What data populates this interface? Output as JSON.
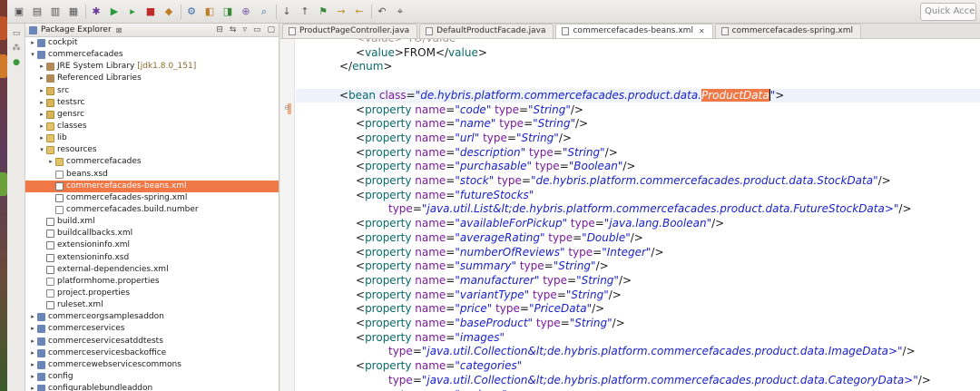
{
  "toolbar": {
    "quick_access_label": "Quick Access",
    "icons": [
      "new-icon",
      "save-icon",
      "save-all-icon",
      "print-icon",
      "debug-icon",
      "run-icon",
      "run-ext-icon",
      "stop-icon",
      "coverage-icon",
      "build-icon",
      "new-java-icon",
      "new-class-icon",
      "open-type-icon",
      "search-icon",
      "next-annotation-icon",
      "prev-annotation-icon",
      "toggle-mark-icon",
      "forward-icon",
      "back-icon",
      "last-edit-icon",
      "pin-icon"
    ]
  },
  "package_explorer": {
    "title": "Package Explorer",
    "items": [
      {
        "label": "cockpit",
        "depth": 0,
        "arrow": "▸",
        "icon": "project"
      },
      {
        "label": "commercefacades",
        "depth": 0,
        "arrow": "▾",
        "icon": "project"
      },
      {
        "label": "JRE System Library",
        "suffix": " [jdk1.8.0_151]",
        "depth": 1,
        "arrow": "▸",
        "icon": "jar"
      },
      {
        "label": "Referenced Libraries",
        "depth": 1,
        "arrow": "▸",
        "icon": "jar"
      },
      {
        "label": "src",
        "depth": 1,
        "arrow": "▸",
        "icon": "pkgfolder"
      },
      {
        "label": "testsrc",
        "depth": 1,
        "arrow": "▸",
        "icon": "pkgfolder"
      },
      {
        "label": "gensrc",
        "depth": 1,
        "arrow": "▸",
        "icon": "pkgfolder"
      },
      {
        "label": "classes",
        "depth": 1,
        "arrow": "▸",
        "icon": "folder"
      },
      {
        "label": "lib",
        "depth": 1,
        "arrow": "▸",
        "icon": "folder"
      },
      {
        "label": "resources",
        "depth": 1,
        "arrow": "▾",
        "icon": "folder"
      },
      {
        "label": "commercefacades",
        "depth": 2,
        "arrow": "▸",
        "icon": "folder"
      },
      {
        "label": "beans.xsd",
        "depth": 2,
        "arrow": "",
        "icon": "file"
      },
      {
        "label": "commercefacades-beans.xml",
        "depth": 2,
        "arrow": "",
        "icon": "xml",
        "selected": true
      },
      {
        "label": "commercefacades-spring.xml",
        "depth": 2,
        "arrow": "",
        "icon": "xml"
      },
      {
        "label": "commercefacades.build.number",
        "depth": 2,
        "arrow": "",
        "icon": "file"
      },
      {
        "label": "build.xml",
        "depth": 1,
        "arrow": "",
        "icon": "xml"
      },
      {
        "label": "buildcallbacks.xml",
        "depth": 1,
        "arrow": "",
        "icon": "xml"
      },
      {
        "label": "extensioninfo.xml",
        "depth": 1,
        "arrow": "",
        "icon": "xml"
      },
      {
        "label": "extensioninfo.xsd",
        "depth": 1,
        "arrow": "",
        "icon": "xml"
      },
      {
        "label": "external-dependencies.xml",
        "depth": 1,
        "arrow": "",
        "icon": "xml"
      },
      {
        "label": "platformhome.properties",
        "depth": 1,
        "arrow": "",
        "icon": "file"
      },
      {
        "label": "project.properties",
        "depth": 1,
        "arrow": "",
        "icon": "file"
      },
      {
        "label": "ruleset.xml",
        "depth": 1,
        "arrow": "",
        "icon": "xml"
      },
      {
        "label": "commerceorgsamplesaddon",
        "depth": 0,
        "arrow": "▸",
        "icon": "project"
      },
      {
        "label": "commerceservices",
        "depth": 0,
        "arrow": "▸",
        "icon": "project"
      },
      {
        "label": "commerceservicesatddtests",
        "depth": 0,
        "arrow": "▸",
        "icon": "project"
      },
      {
        "label": "commerceservicesbackoffice",
        "depth": 0,
        "arrow": "▸",
        "icon": "project"
      },
      {
        "label": "commercewebservicescommons",
        "depth": 0,
        "arrow": "▸",
        "icon": "project"
      },
      {
        "label": "config",
        "depth": 0,
        "arrow": "▸",
        "icon": "project"
      },
      {
        "label": "configurablebundleaddon",
        "depth": 0,
        "arrow": "▸",
        "icon": "project"
      }
    ]
  },
  "editor": {
    "tabs": [
      {
        "label": "ProductPageController.java",
        "active": false,
        "closable": false
      },
      {
        "label": "DefaultProductFacade.java",
        "active": false,
        "closable": false
      },
      {
        "label": "commercefacades-beans.xml",
        "active": true,
        "closable": true
      },
      {
        "label": "commercefacades-spring.xml",
        "active": false,
        "closable": false
      }
    ],
    "close_glyph": "✕",
    "lines": [
      {
        "indent": 2,
        "ghost": true,
        "segs": [
          [
            "p",
            "<"
          ],
          [
            "t",
            "value"
          ],
          [
            "p",
            "> "
          ],
          [
            "s",
            "TO/value"
          ]
        ]
      },
      {
        "indent": 2,
        "segs": [
          [
            "p",
            "<"
          ],
          [
            "t",
            "value"
          ],
          [
            "p",
            ">FROM</"
          ],
          [
            "t",
            "value"
          ],
          [
            "p",
            ">"
          ]
        ]
      },
      {
        "indent": 1,
        "segs": [
          [
            "p",
            "</"
          ],
          [
            "t",
            "enum"
          ],
          [
            "p",
            ">"
          ]
        ]
      },
      {
        "indent": 0,
        "segs": []
      },
      {
        "indent": 1,
        "cur": true,
        "segs": [
          [
            "p",
            "<"
          ],
          [
            "t",
            "bean"
          ],
          [
            "a",
            " class"
          ],
          [
            "p",
            "="
          ],
          [
            "s",
            "\"de.hybris.platform.commercefacades.product.data."
          ],
          [
            "hl",
            "ProductData"
          ],
          [
            "caret",
            ""
          ],
          [
            "s",
            "\""
          ],
          [
            "p",
            ">"
          ]
        ]
      },
      {
        "indent": 2,
        "segs": [
          [
            "p",
            "<"
          ],
          [
            "t",
            "property"
          ],
          [
            "a",
            " name"
          ],
          [
            "p",
            "="
          ],
          [
            "s",
            "\"code\""
          ],
          [
            "a",
            " type"
          ],
          [
            "p",
            "="
          ],
          [
            "s",
            "\"String\""
          ],
          [
            "p",
            "/>"
          ]
        ]
      },
      {
        "indent": 2,
        "segs": [
          [
            "p",
            "<"
          ],
          [
            "t",
            "property"
          ],
          [
            "a",
            " name"
          ],
          [
            "p",
            "="
          ],
          [
            "s",
            "\"name\""
          ],
          [
            "a",
            " type"
          ],
          [
            "p",
            "="
          ],
          [
            "s",
            "\"String\""
          ],
          [
            "p",
            "/>"
          ]
        ]
      },
      {
        "indent": 2,
        "segs": [
          [
            "p",
            "<"
          ],
          [
            "t",
            "property"
          ],
          [
            "a",
            " name"
          ],
          [
            "p",
            "="
          ],
          [
            "s",
            "\"url\""
          ],
          [
            "a",
            " type"
          ],
          [
            "p",
            "="
          ],
          [
            "s",
            "\"String\""
          ],
          [
            "p",
            "/>"
          ]
        ]
      },
      {
        "indent": 2,
        "segs": [
          [
            "p",
            "<"
          ],
          [
            "t",
            "property"
          ],
          [
            "a",
            " name"
          ],
          [
            "p",
            "="
          ],
          [
            "s",
            "\"description\""
          ],
          [
            "a",
            " type"
          ],
          [
            "p",
            "="
          ],
          [
            "s",
            "\"String\""
          ],
          [
            "p",
            "/>"
          ]
        ]
      },
      {
        "indent": 2,
        "segs": [
          [
            "p",
            "<"
          ],
          [
            "t",
            "property"
          ],
          [
            "a",
            " name"
          ],
          [
            "p",
            "="
          ],
          [
            "s",
            "\"purchasable\""
          ],
          [
            "a",
            " type"
          ],
          [
            "p",
            "="
          ],
          [
            "s",
            "\"Boolean\""
          ],
          [
            "p",
            "/>"
          ]
        ]
      },
      {
        "indent": 2,
        "segs": [
          [
            "p",
            "<"
          ],
          [
            "t",
            "property"
          ],
          [
            "a",
            " name"
          ],
          [
            "p",
            "="
          ],
          [
            "s",
            "\"stock\""
          ],
          [
            "a",
            " type"
          ],
          [
            "p",
            "="
          ],
          [
            "s",
            "\"de.hybris.platform.commercefacades.product.data.StockData\""
          ],
          [
            "p",
            "/>"
          ]
        ]
      },
      {
        "indent": 2,
        "segs": [
          [
            "p",
            "<"
          ],
          [
            "t",
            "property"
          ],
          [
            "a",
            " name"
          ],
          [
            "p",
            "="
          ],
          [
            "s",
            "\"futureStocks\""
          ]
        ]
      },
      {
        "indent": 4,
        "segs": [
          [
            "a",
            "type"
          ],
          [
            "p",
            "="
          ],
          [
            "s",
            "\"java.util.List&lt;de.hybris.platform.commercefacades.product.data.FutureStockData>\""
          ],
          [
            "p",
            "/>"
          ]
        ]
      },
      {
        "indent": 2,
        "segs": [
          [
            "p",
            "<"
          ],
          [
            "t",
            "property"
          ],
          [
            "a",
            " name"
          ],
          [
            "p",
            "="
          ],
          [
            "s",
            "\"availableForPickup\""
          ],
          [
            "a",
            " type"
          ],
          [
            "p",
            "="
          ],
          [
            "s",
            "\"java.lang.Boolean\""
          ],
          [
            "p",
            "/>"
          ]
        ]
      },
      {
        "indent": 2,
        "segs": [
          [
            "p",
            "<"
          ],
          [
            "t",
            "property"
          ],
          [
            "a",
            " name"
          ],
          [
            "p",
            "="
          ],
          [
            "s",
            "\"averageRating\""
          ],
          [
            "a",
            " type"
          ],
          [
            "p",
            "="
          ],
          [
            "s",
            "\"Double\""
          ],
          [
            "p",
            "/>"
          ]
        ]
      },
      {
        "indent": 2,
        "segs": [
          [
            "p",
            "<"
          ],
          [
            "t",
            "property"
          ],
          [
            "a",
            " name"
          ],
          [
            "p",
            "="
          ],
          [
            "s",
            "\"numberOfReviews\""
          ],
          [
            "a",
            " type"
          ],
          [
            "p",
            "="
          ],
          [
            "s",
            "\"Integer\""
          ],
          [
            "p",
            "/>"
          ]
        ]
      },
      {
        "indent": 2,
        "segs": [
          [
            "p",
            "<"
          ],
          [
            "t",
            "property"
          ],
          [
            "a",
            " name"
          ],
          [
            "p",
            "="
          ],
          [
            "s",
            "\"summary\""
          ],
          [
            "a",
            " type"
          ],
          [
            "p",
            "="
          ],
          [
            "s",
            "\"String\""
          ],
          [
            "p",
            "/>"
          ]
        ]
      },
      {
        "indent": 2,
        "segs": [
          [
            "p",
            "<"
          ],
          [
            "t",
            "property"
          ],
          [
            "a",
            " name"
          ],
          [
            "p",
            "="
          ],
          [
            "s",
            "\"manufacturer\""
          ],
          [
            "a",
            " type"
          ],
          [
            "p",
            "="
          ],
          [
            "s",
            "\"String\""
          ],
          [
            "p",
            "/>"
          ]
        ]
      },
      {
        "indent": 2,
        "segs": [
          [
            "p",
            "<"
          ],
          [
            "t",
            "property"
          ],
          [
            "a",
            " name"
          ],
          [
            "p",
            "="
          ],
          [
            "s",
            "\"variantType\""
          ],
          [
            "a",
            " type"
          ],
          [
            "p",
            "="
          ],
          [
            "s",
            "\"String\""
          ],
          [
            "p",
            "/>"
          ]
        ]
      },
      {
        "indent": 2,
        "segs": [
          [
            "p",
            "<"
          ],
          [
            "t",
            "property"
          ],
          [
            "a",
            " name"
          ],
          [
            "p",
            "="
          ],
          [
            "s",
            "\"price\""
          ],
          [
            "a",
            " type"
          ],
          [
            "p",
            "="
          ],
          [
            "s",
            "\"PriceData\""
          ],
          [
            "p",
            "/>"
          ]
        ]
      },
      {
        "indent": 2,
        "segs": [
          [
            "p",
            "<"
          ],
          [
            "t",
            "property"
          ],
          [
            "a",
            " name"
          ],
          [
            "p",
            "="
          ],
          [
            "s",
            "\"baseProduct\""
          ],
          [
            "a",
            " type"
          ],
          [
            "p",
            "="
          ],
          [
            "s",
            "\"String\""
          ],
          [
            "p",
            "/>"
          ]
        ]
      },
      {
        "indent": 2,
        "segs": [
          [
            "p",
            "<"
          ],
          [
            "t",
            "property"
          ],
          [
            "a",
            " name"
          ],
          [
            "p",
            "="
          ],
          [
            "s",
            "\"images\""
          ]
        ]
      },
      {
        "indent": 4,
        "segs": [
          [
            "a",
            "type"
          ],
          [
            "p",
            "="
          ],
          [
            "s",
            "\"java.util.Collection&lt;de.hybris.platform.commercefacades.product.data.ImageData>\""
          ],
          [
            "p",
            "/>"
          ]
        ]
      },
      {
        "indent": 2,
        "segs": [
          [
            "p",
            "<"
          ],
          [
            "t",
            "property"
          ],
          [
            "a",
            " name"
          ],
          [
            "p",
            "="
          ],
          [
            "s",
            "\"categories\""
          ]
        ]
      },
      {
        "indent": 4,
        "segs": [
          [
            "a",
            "type"
          ],
          [
            "p",
            "="
          ],
          [
            "s",
            "\"java.util.Collection&lt;de.hybris.platform.commercefacades.product.data.CategoryData>\""
          ],
          [
            "p",
            "/>"
          ]
        ]
      },
      {
        "indent": 2,
        "segs": [
          [
            "p",
            "<"
          ],
          [
            "t",
            "property"
          ],
          [
            "a",
            " name"
          ],
          [
            "p",
            "="
          ],
          [
            "s",
            "\"reviews\""
          ]
        ]
      }
    ]
  },
  "colors": {
    "selection": "#f07746",
    "tag": "#0a6a6a",
    "attribute": "#7a1a9a",
    "string": "#1a22c8"
  }
}
